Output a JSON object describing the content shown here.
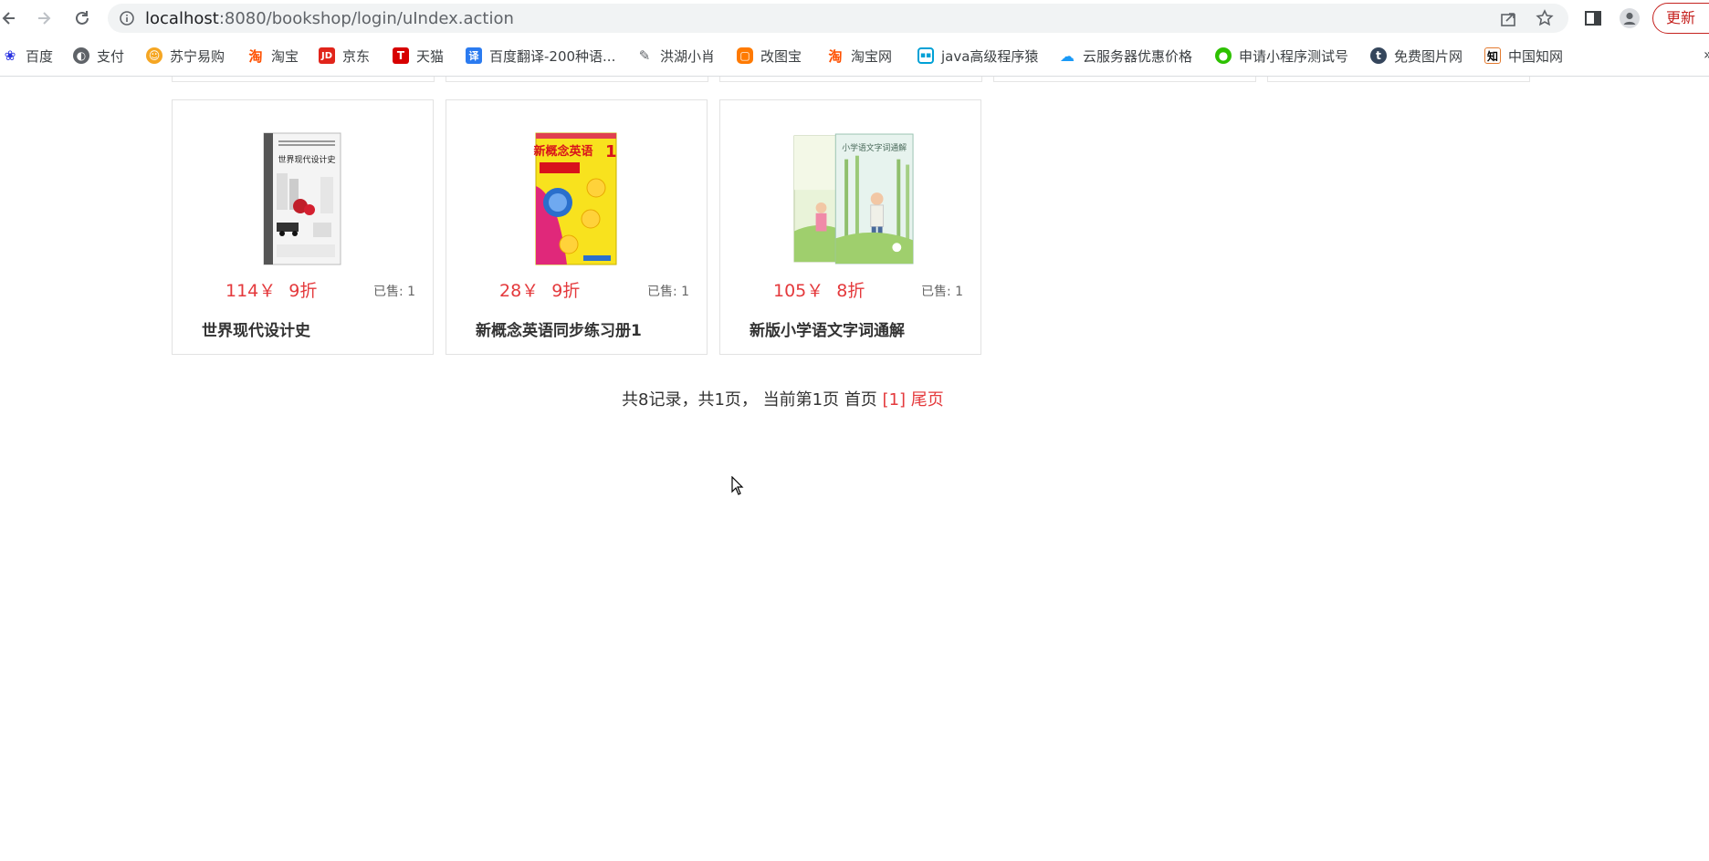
{
  "browser": {
    "url_host": "localhost",
    "url_rest": ":8080/bookshop/login/uIndex.action",
    "update_label": "更新"
  },
  "bookmarks": [
    {
      "label": "百度",
      "icon": "baidu-paw-icon",
      "color": "#2932e1"
    },
    {
      "label": "支付",
      "icon": "globe-icon",
      "color": "#5f6368"
    },
    {
      "label": "苏宁易购",
      "icon": "suning-lion-icon",
      "color": "#f5a623"
    },
    {
      "label": "淘宝",
      "icon": "taobao-icon",
      "color": "#ff5000"
    },
    {
      "label": "京东",
      "icon": "jd-icon",
      "color": "#e1251b"
    },
    {
      "label": "天猫",
      "icon": "tmall-icon",
      "color": "#d70000"
    },
    {
      "label": "百度翻译-200种语...",
      "icon": "baidu-translate-icon",
      "color": "#2b7bf0"
    },
    {
      "label": "洪湖小肖",
      "icon": "bird-icon",
      "color": "#5f6368"
    },
    {
      "label": "改图宝",
      "icon": "gaitubao-icon",
      "color": "#ff7a00"
    },
    {
      "label": "淘宝网",
      "icon": "taobao-icon",
      "color": "#ff5000"
    },
    {
      "label": "java高级程序猿",
      "icon": "bilibili-icon",
      "color": "#00a1d6"
    },
    {
      "label": "云服务器优惠价格",
      "icon": "cloud-icon",
      "color": "#1a9af7"
    },
    {
      "label": "申请小程序测试号",
      "icon": "wechat-icon",
      "color": "#2dc100"
    },
    {
      "label": "免费图片网",
      "icon": "tumblr-icon",
      "color": "#35465c"
    },
    {
      "label": "中国知网",
      "icon": "cnki-icon",
      "color": "#000000"
    }
  ],
  "books": [
    {
      "price": "114￥",
      "discount": "9折",
      "sold": "已售: 1",
      "title": "世界现代设计史",
      "cover_title": "世界现代设计史"
    },
    {
      "price": "28￥",
      "discount": "9折",
      "sold": "已售: 1",
      "title": "新概念英语同步练习册1",
      "cover_title": "新概念英语"
    },
    {
      "price": "105￥",
      "discount": "8折",
      "sold": "已售: 1",
      "title": "新版小学语文字词通解",
      "cover_title": "小学语文字词通解"
    }
  ],
  "pager": {
    "summary": "共8记录，共1页，  当前第1页",
    "first": "首页",
    "current": "[1]",
    "last": "尾页"
  }
}
